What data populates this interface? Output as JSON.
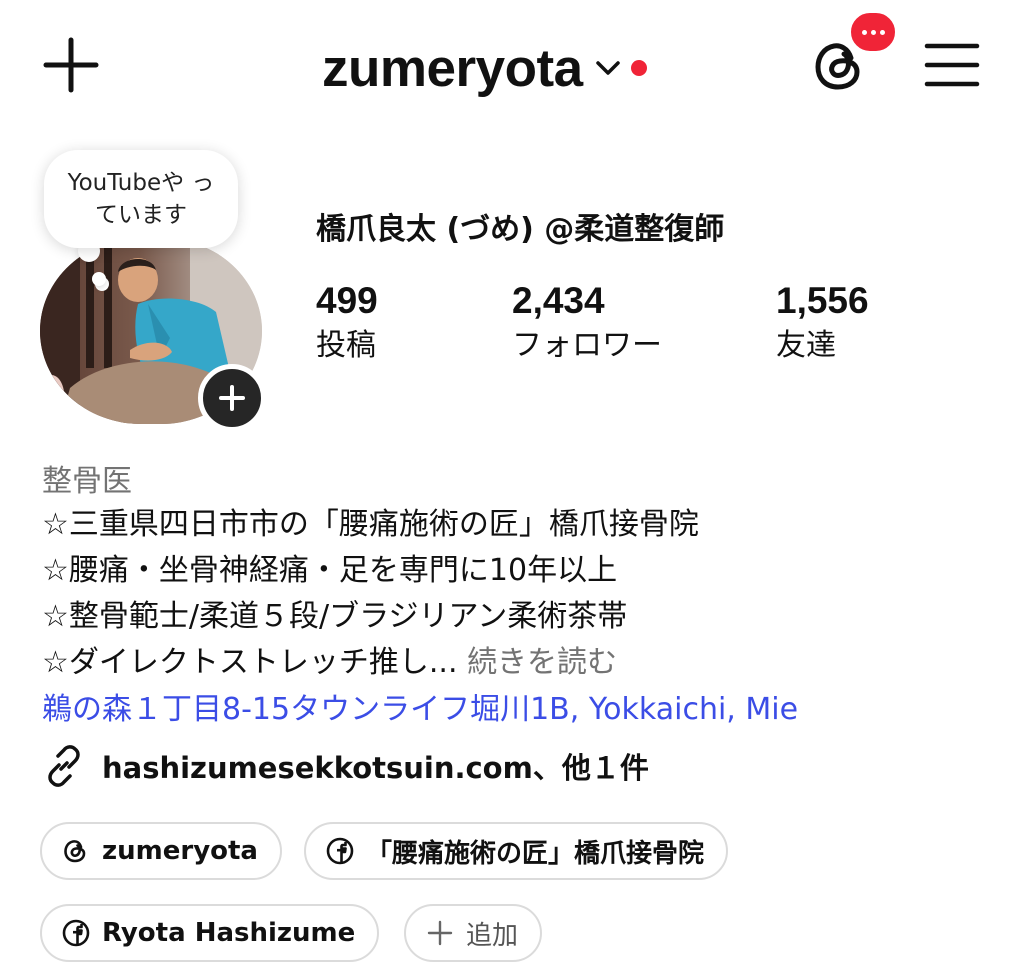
{
  "header": {
    "username": "zumeryota",
    "icons": {
      "create": "plus-icon",
      "account_switcher": "chevron-down-icon",
      "threads": "threads-icon",
      "menu": "hamburger-menu-icon"
    },
    "accent_red": "#f02437"
  },
  "profile": {
    "note": "YouTubeや っています",
    "display_name": "橋爪良太 (づめ) @柔道整復師",
    "stats": [
      {
        "value": "499",
        "label": "投稿"
      },
      {
        "value": "2,434",
        "label": "フォロワー"
      },
      {
        "value": "1,556",
        "label": "友達"
      }
    ]
  },
  "bio": {
    "category": "整骨医",
    "lines": [
      "☆三重県四日市市の「腰痛施術の匠」橋爪接骨院",
      "☆腰痛・坐骨神経痛・足を専門に10年以上",
      "☆整骨範士/柔道５段/ブラジリアン柔術茶帯",
      "☆ダイレクトストレッチ推し..."
    ],
    "more_label": "続きを読む",
    "address": "鵜の森１丁目8-15タウンライフ堀川1B, Yokkaichi, Mie",
    "link": "hashizumesekkotsuin.com、他１件",
    "link_color": "#3b4de6"
  },
  "chips": [
    {
      "icon": "threads-icon",
      "label": "zumeryota"
    },
    {
      "icon": "facebook-icon",
      "label": "「腰痛施術の匠」橋爪接骨院"
    },
    {
      "icon": "facebook-icon",
      "label": "Ryota Hashizume"
    },
    {
      "icon": "plus-icon",
      "label": "追加"
    }
  ]
}
